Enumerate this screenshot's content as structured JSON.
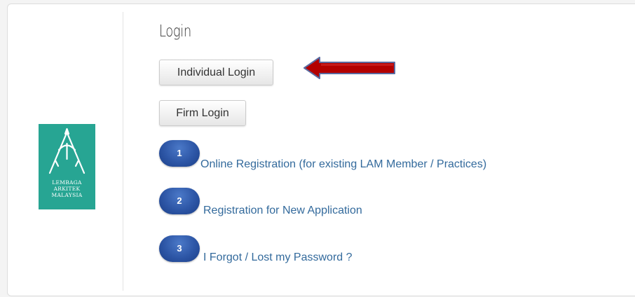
{
  "logo": {
    "lines": [
      "LEMBAGA",
      "ARKITEK",
      "MALAYSIA"
    ],
    "background_color": "#27a593"
  },
  "panel": {
    "title": "Login"
  },
  "buttons": {
    "individual_login": "Individual Login",
    "firm_login": "Firm Login"
  },
  "annotation": {
    "icon": "left-pointing-arrow",
    "color": "#b30000"
  },
  "links": [
    {
      "number": "1",
      "label": "Online Registration (for existing LAM Member / Practices)"
    },
    {
      "number": "2",
      "label": "Registration for New Application"
    },
    {
      "number": "3",
      "label": "I Forgot / Lost my Password ?"
    }
  ],
  "colors": {
    "link": "#336a9c",
    "number_badge": "#2d56a6"
  }
}
